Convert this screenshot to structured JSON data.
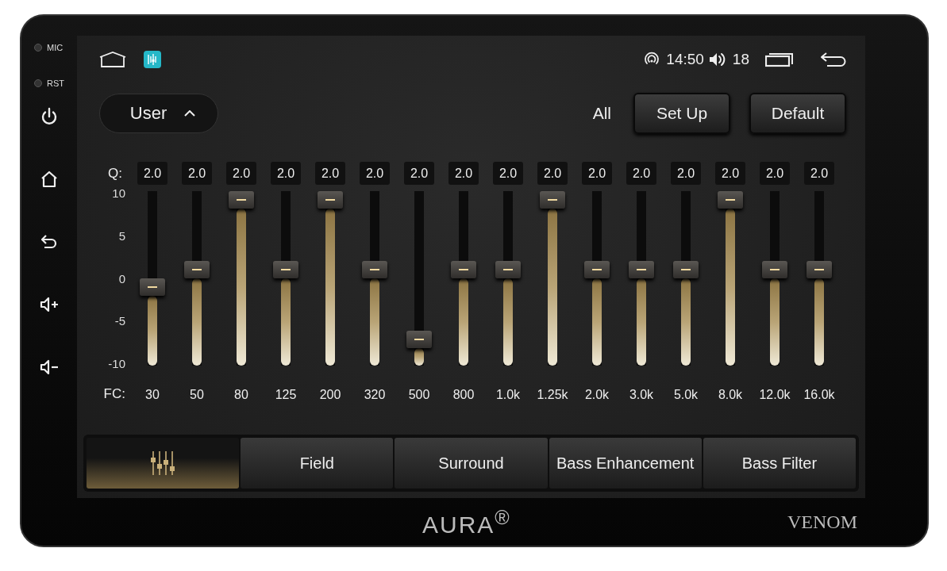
{
  "side_panel": {
    "labels": [
      "MIC",
      "RST"
    ]
  },
  "status_bar": {
    "time": "14:50",
    "volume": "18"
  },
  "preset": {
    "label": "User"
  },
  "toolbar": {
    "scope": "All",
    "buttons": [
      "Set Up",
      "Default"
    ]
  },
  "equalizer": {
    "q_label": "Q:",
    "fc_label": "FC:",
    "scale": [
      "10",
      "5",
      "0",
      "-5",
      "-10"
    ],
    "bands": [
      {
        "q": "2.0",
        "fc": "30",
        "level": 0.4
      },
      {
        "q": "2.0",
        "fc": "50",
        "level": 0.5
      },
      {
        "q": "2.0",
        "fc": "80",
        "level": 0.9
      },
      {
        "q": "2.0",
        "fc": "125",
        "level": 0.5
      },
      {
        "q": "2.0",
        "fc": "200",
        "level": 0.9
      },
      {
        "q": "2.0",
        "fc": "320",
        "level": 0.5
      },
      {
        "q": "2.0",
        "fc": "500",
        "level": 0.1
      },
      {
        "q": "2.0",
        "fc": "800",
        "level": 0.5
      },
      {
        "q": "2.0",
        "fc": "1.0k",
        "level": 0.5
      },
      {
        "q": "2.0",
        "fc": "1.25k",
        "level": 0.9
      },
      {
        "q": "2.0",
        "fc": "2.0k",
        "level": 0.5
      },
      {
        "q": "2.0",
        "fc": "3.0k",
        "level": 0.5
      },
      {
        "q": "2.0",
        "fc": "5.0k",
        "level": 0.5
      },
      {
        "q": "2.0",
        "fc": "8.0k",
        "level": 0.9
      },
      {
        "q": "2.0",
        "fc": "12.0k",
        "level": 0.5
      },
      {
        "q": "2.0",
        "fc": "16.0k",
        "level": 0.5
      }
    ]
  },
  "tabs": [
    {
      "kind": "icon",
      "selected": true
    },
    {
      "kind": "text",
      "label": "Field",
      "selected": false
    },
    {
      "kind": "text",
      "label": "Surround",
      "selected": false
    },
    {
      "kind": "text",
      "label": "Bass Enhancement",
      "selected": false
    },
    {
      "kind": "text",
      "label": "Bass Filter",
      "selected": false
    }
  ],
  "bezel": {
    "brand": "AURA$^{®}$",
    "model": "VENOM"
  }
}
